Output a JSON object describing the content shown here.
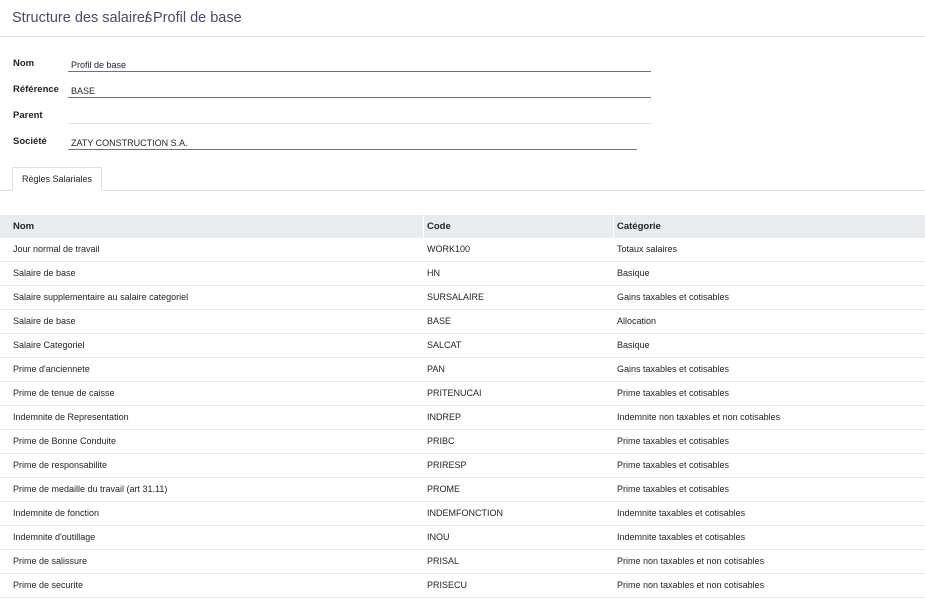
{
  "breadcrumb": {
    "parent": "Structure des salaires",
    "separator": "/",
    "current": "Profil de base"
  },
  "form": {
    "name_label": "Nom",
    "name_value": "Profil de base",
    "reference_label": "Référence",
    "reference_value": "BASE",
    "parent_label": "Parent",
    "parent_value": "",
    "company_label": "Société",
    "company_value": "ZATY CONSTRUCTION S.A."
  },
  "tabs": [
    {
      "label": "Règles Salariales"
    }
  ],
  "table": {
    "headers": [
      "Nom",
      "Code",
      "Catégorie"
    ],
    "rows": [
      {
        "nom": "Jour normal de travail",
        "code": "WORK100",
        "categorie": "Totaux salaires"
      },
      {
        "nom": "Salaire de base",
        "code": "HN",
        "categorie": "Basique"
      },
      {
        "nom": "Salaire supplementaire au salaire categoriel",
        "code": "SURSALAIRE",
        "categorie": "Gains taxables et cotisables"
      },
      {
        "nom": "Salaire de base",
        "code": "BASE",
        "categorie": "Allocation"
      },
      {
        "nom": "Salaire Categoriel",
        "code": "SALCAT",
        "categorie": "Basique"
      },
      {
        "nom": "Prime d'anciennete",
        "code": "PAN",
        "categorie": "Gains taxables et cotisables"
      },
      {
        "nom": "Prime de tenue de caisse",
        "code": "PRITENUCAI",
        "categorie": "Prime taxables et cotisables"
      },
      {
        "nom": "Indemnite de Representation",
        "code": "INDREP",
        "categorie": "Indemnite non taxables et non cotisables"
      },
      {
        "nom": "Prime de Bonne Conduite",
        "code": "PRIBC",
        "categorie": "Prime taxables et cotisables"
      },
      {
        "nom": "Prime de responsabilite",
        "code": "PRIRESP",
        "categorie": "Prime taxables et cotisables"
      },
      {
        "nom": "Prime de medaille du travail (art 31.11)",
        "code": "PROME",
        "categorie": "Prime taxables et cotisables"
      },
      {
        "nom": "Indemnite de fonction",
        "code": "INDEMFONCTION",
        "categorie": "Indemnite taxables et cotisables"
      },
      {
        "nom": "Indemnite d'outillage",
        "code": "INOU",
        "categorie": "Indemnite taxables et cotisables"
      },
      {
        "nom": "Prime de salissure",
        "code": "PRISAL",
        "categorie": "Prime non taxables et non cotisables"
      },
      {
        "nom": "Prime de securite",
        "code": "PRISECU",
        "categorie": "Prime non taxables et non cotisables"
      }
    ]
  }
}
